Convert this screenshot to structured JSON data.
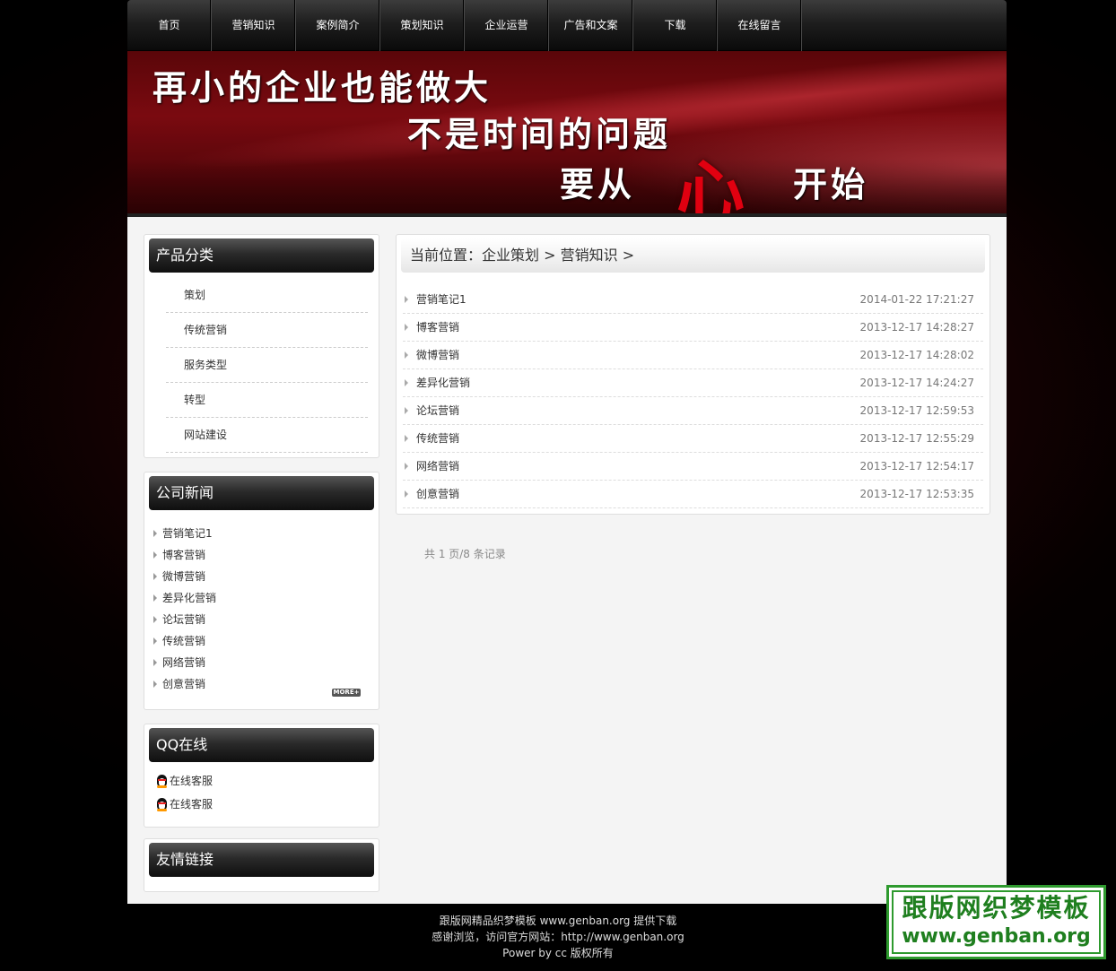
{
  "nav": {
    "items": [
      "首页",
      "营销知识",
      "案例简介",
      "策划知识",
      "企业运营",
      "广告和文案",
      "下载",
      "在线留言"
    ]
  },
  "banner": {
    "line1": "再小的企业也能做大",
    "line2": "不是时间的问题",
    "line3_left": "要从",
    "line3_heart": "心",
    "line3_right": "开始"
  },
  "categories": {
    "title": "产品分类",
    "items": [
      "策划",
      "传统营销",
      "服务类型",
      "转型",
      "网站建设"
    ]
  },
  "news": {
    "title": "公司新闻",
    "items": [
      "营销笔记1",
      "博客营销",
      "微博营销",
      "差异化营销",
      "论坛营销",
      "传统营销",
      "网络营销",
      "创意营销"
    ],
    "more": "MORE+"
  },
  "qq": {
    "title": "QQ在线",
    "items": [
      "在线客服",
      "在线客服"
    ]
  },
  "links": {
    "title": "友情链接"
  },
  "breadcrumb": {
    "label": "当前位置：",
    "level1": "企业策划",
    "sep": " > ",
    "level2": "营销知识",
    "tail": " >"
  },
  "articles": [
    {
      "title": "营销笔记1",
      "date": "2014-01-22 17:21:27"
    },
    {
      "title": "博客营销",
      "date": "2013-12-17 14:28:27"
    },
    {
      "title": "微博营销",
      "date": "2013-12-17 14:28:02"
    },
    {
      "title": "差异化营销",
      "date": "2013-12-17 14:24:27"
    },
    {
      "title": "论坛营销",
      "date": "2013-12-17 12:59:53"
    },
    {
      "title": "传统营销",
      "date": "2013-12-17 12:55:29"
    },
    {
      "title": "网络营销",
      "date": "2013-12-17 12:54:17"
    },
    {
      "title": "创意营销",
      "date": "2013-12-17 12:53:35"
    }
  ],
  "pager": {
    "text": "共 1 页/8 条记录"
  },
  "footer": {
    "line1": "跟版网精品织梦模板 www.genban.org 提供下载",
    "line2": "感谢浏览，访问官方网站：http://www.genban.org",
    "line3": "Power by cc 版权所有"
  },
  "watermark": {
    "cn": "跟版网织梦模板",
    "url": "www.genban.org"
  },
  "colors": {
    "accent_red": "#e00010",
    "watermark_green": "#2e9a2e"
  }
}
